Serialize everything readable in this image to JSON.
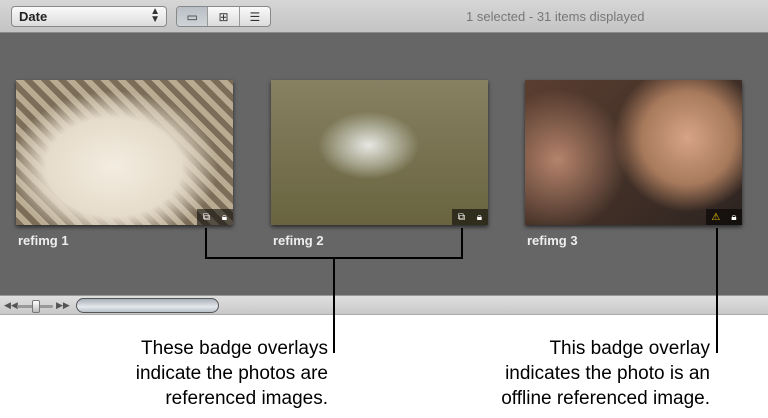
{
  "toolbar": {
    "sort_value": "Date",
    "view_modes": [
      "filmstrip",
      "grid",
      "list"
    ],
    "status": "1 selected - 31 items displayed"
  },
  "images": [
    {
      "label": "refimg 1",
      "badges": [
        "referenced-icon",
        "locked-icon"
      ]
    },
    {
      "label": "refimg 2",
      "badges": [
        "referenced-icon",
        "locked-icon"
      ]
    },
    {
      "label": "refimg 3",
      "badges": [
        "offline-referenced-icon",
        "locked-icon"
      ]
    }
  ],
  "callouts": {
    "left": [
      "These badge overlays",
      "indicate the photos are",
      "referenced images."
    ],
    "right": [
      "This badge overlay",
      "indicates the photo is an",
      "offline referenced image."
    ]
  }
}
